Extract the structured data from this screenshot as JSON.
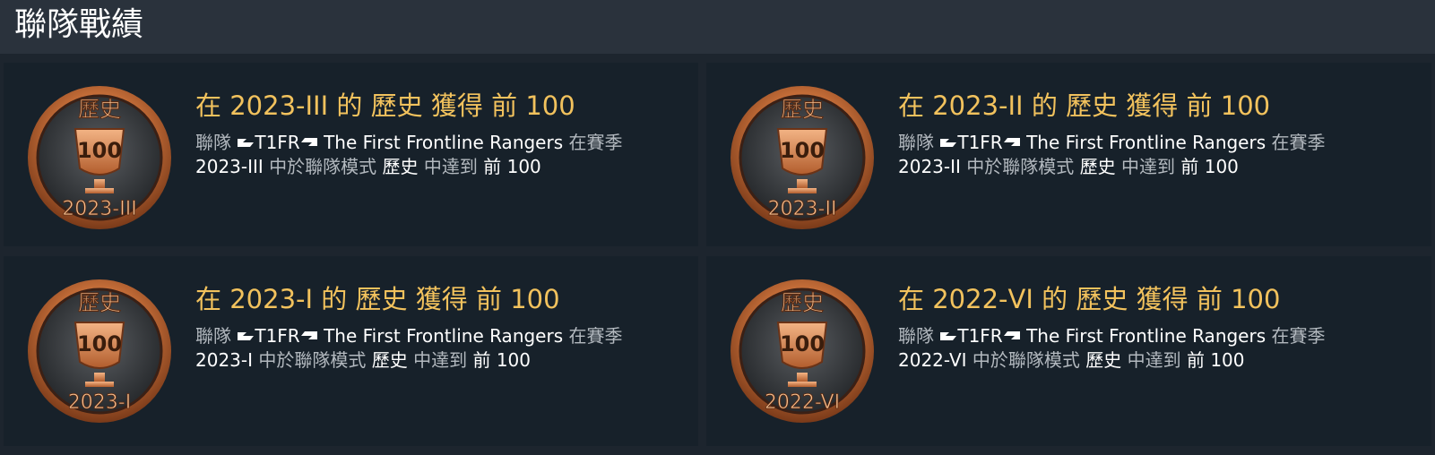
{
  "header": {
    "title": "聯隊戰績"
  },
  "strings": {
    "title_pre": "在",
    "title_of": "的",
    "title_got": "獲得",
    "desc_line1_pre": "聯隊",
    "desc_line1_post": "在賽季",
    "desc_mid": "中於聯隊模式",
    "desc_reach": "中達到"
  },
  "squad": {
    "tag": "T1FR",
    "name": "The First Frontline Rangers"
  },
  "achievements": [
    {
      "season": "2023-III",
      "mode": "歷史",
      "rank_prefix": "前",
      "rank": "100",
      "medal_top": "歷史",
      "medal_center": "100",
      "medal_bottom": "2023-III"
    },
    {
      "season": "2023-II",
      "mode": "歷史",
      "rank_prefix": "前",
      "rank": "100",
      "medal_top": "歷史",
      "medal_center": "100",
      "medal_bottom": "2023-II"
    },
    {
      "season": "2023-I",
      "mode": "歷史",
      "rank_prefix": "前",
      "rank": "100",
      "medal_top": "歷史",
      "medal_center": "100",
      "medal_bottom": "2023-I"
    },
    {
      "season": "2022-VI",
      "mode": "歷史",
      "rank_prefix": "前",
      "rank": "100",
      "medal_top": "歷史",
      "medal_center": "100",
      "medal_bottom": "2022-VI"
    }
  ],
  "colors": {
    "header_bg": "#2a323c",
    "card_bg": "#17212a",
    "title_gold": "#f2c25d",
    "desc_gray": "#b3b9bf",
    "medal_copper": "#c8703a"
  },
  "icons": {
    "medal": "trophy-medal-icon",
    "tag_left": "squad-tag-left-icon",
    "tag_right": "squad-tag-right-icon"
  }
}
